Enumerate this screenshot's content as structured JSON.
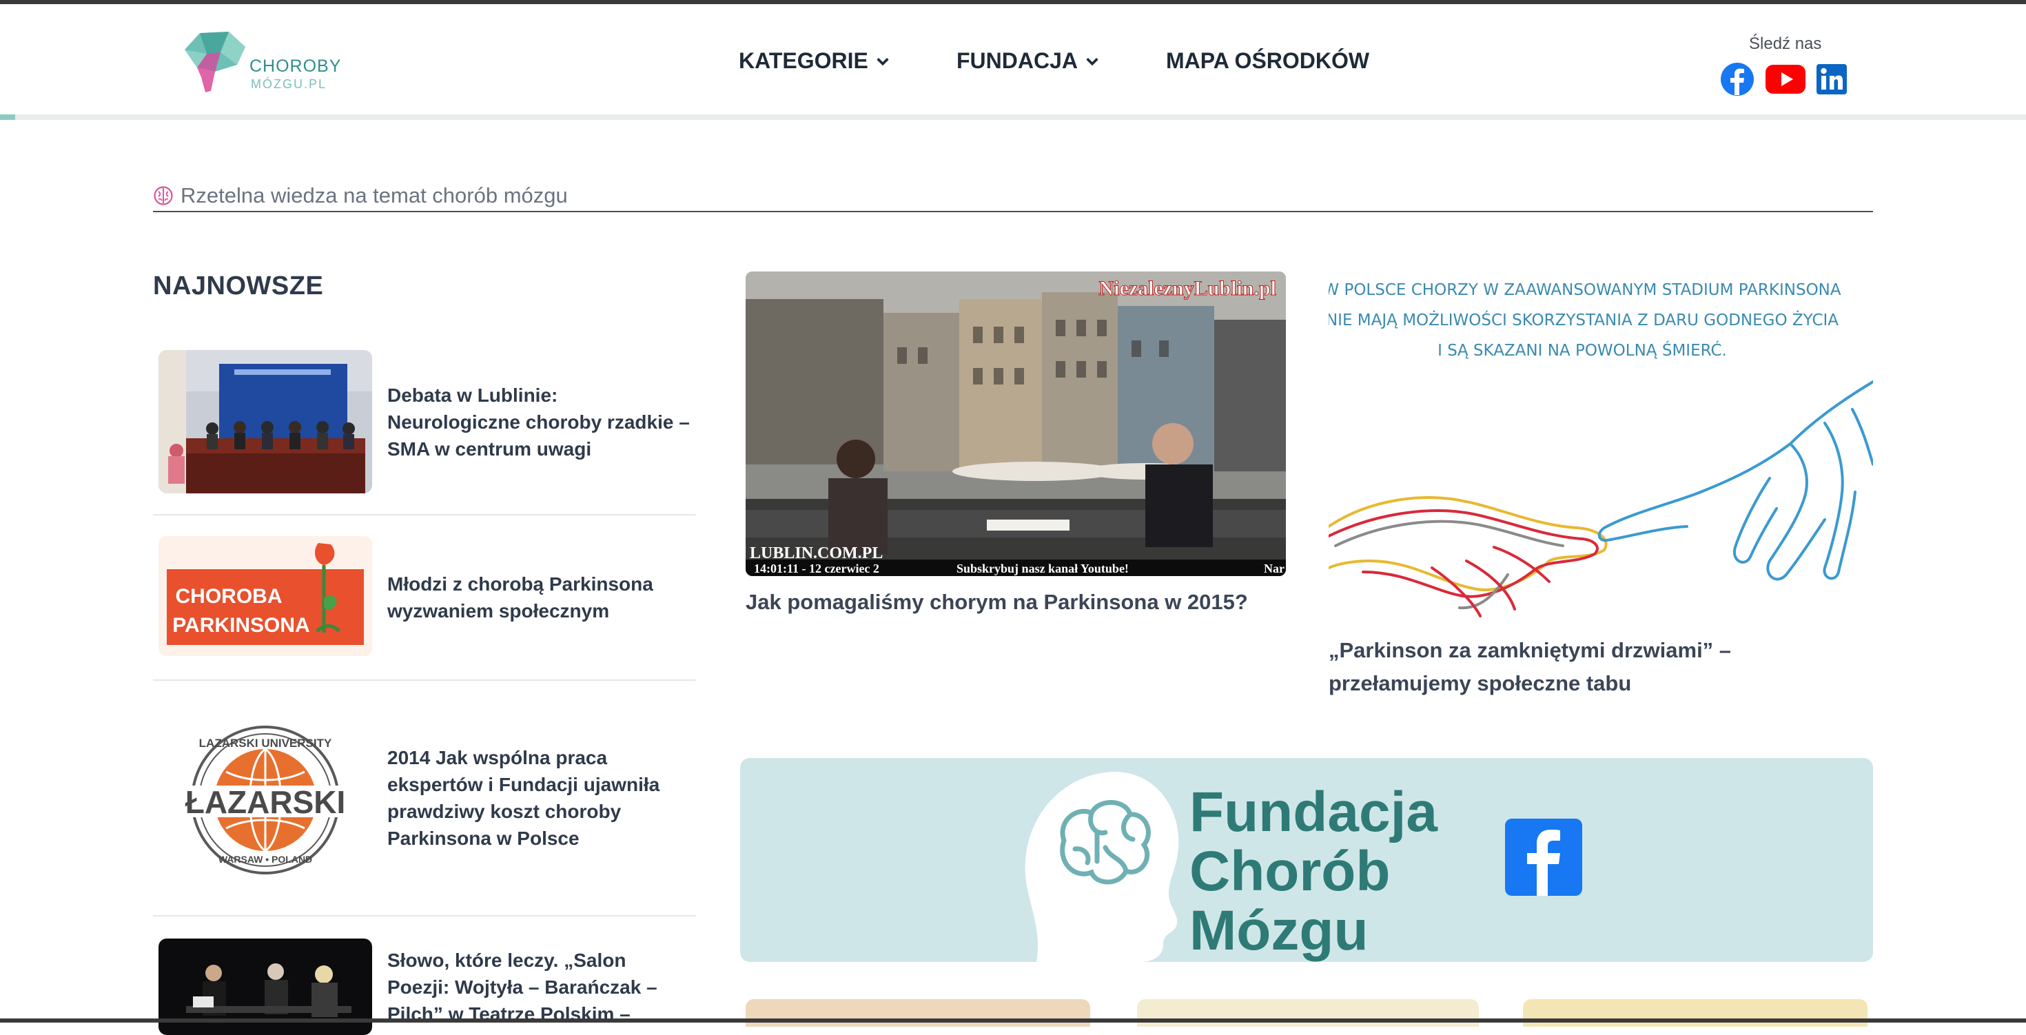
{
  "header": {
    "logo": {
      "line1": "CHOROBY",
      "line2": "MÓZGU.PL"
    },
    "nav": [
      {
        "label": "KATEGORIE",
        "has_dropdown": true
      },
      {
        "label": "FUNDACJA",
        "has_dropdown": true
      },
      {
        "label": "MAPA OŚRODKÓW",
        "has_dropdown": false
      }
    ],
    "social": {
      "label": "Śledź nas",
      "icons": [
        "facebook-icon",
        "youtube-icon",
        "linkedin-icon"
      ]
    }
  },
  "tagline": {
    "icon": "brain-icon",
    "text": "Rzetelna wiedza na temat chorób mózgu"
  },
  "latest": {
    "title": "NAJNOWSZE",
    "items": [
      {
        "title": "Debata w Lublinie: Neurologiczne choroby rzadkie – SMA w centrum uwagi"
      },
      {
        "title": "Młodzi z chorobą Parkinsona wyzwaniem społecznym",
        "thumb_text": [
          "CHOROBA",
          "PARKINSONA"
        ]
      },
      {
        "title": "2014 Jak wspólna praca ekspertów i Fundacji ujawniła prawdziwy koszt choroby Parkinsona w Polsce",
        "thumb_text": [
          "LAZARSKI UNIVERSITY",
          "ŁAZARSKI",
          "WARSAW • POLAND"
        ]
      },
      {
        "title": "Słowo, które leczy. „Salon Poezji: Wojtyła – Barańczak – Pilch” w Teatrze Polskim –"
      }
    ]
  },
  "featured": [
    {
      "title": "Jak pomagaliśmy chorym na Parkinsona w 2015?",
      "image_overlay": {
        "brand": "NiezaleznyLublin.pl",
        "station": "LUBLIN.COM.PL",
        "timestamp": "14:01:11 - 12 czerwiec 2",
        "subscribe": "Subskrybuj nasz kanał Youtube!",
        "cut": "Nar"
      }
    },
    {
      "title": "„Parkinson za zamkniętymi drzwiami” – przełamujemy społeczne tabu",
      "image_caption": [
        "W POLSCE CHORZY W ZAAWANSOWANYM STADIUM PARKINSONA",
        "NIE MAJĄ MOŻLIWOŚCI SKORZYSTANIA Z DARU GODNEGO ŻYCIA",
        "I SĄ SKAZANI NA POWOLNĄ ŚMIERĆ."
      ]
    }
  ],
  "banner": {
    "lines": [
      "Fundacja",
      "Chorób",
      "Mózgu"
    ],
    "icon": "facebook-icon"
  },
  "colors": {
    "accent": "#2f8e8a",
    "banner_bg": "#cfe6e8",
    "facebook": "#1877f2",
    "youtube": "#ff0000",
    "linkedin": "#0a66c2"
  }
}
